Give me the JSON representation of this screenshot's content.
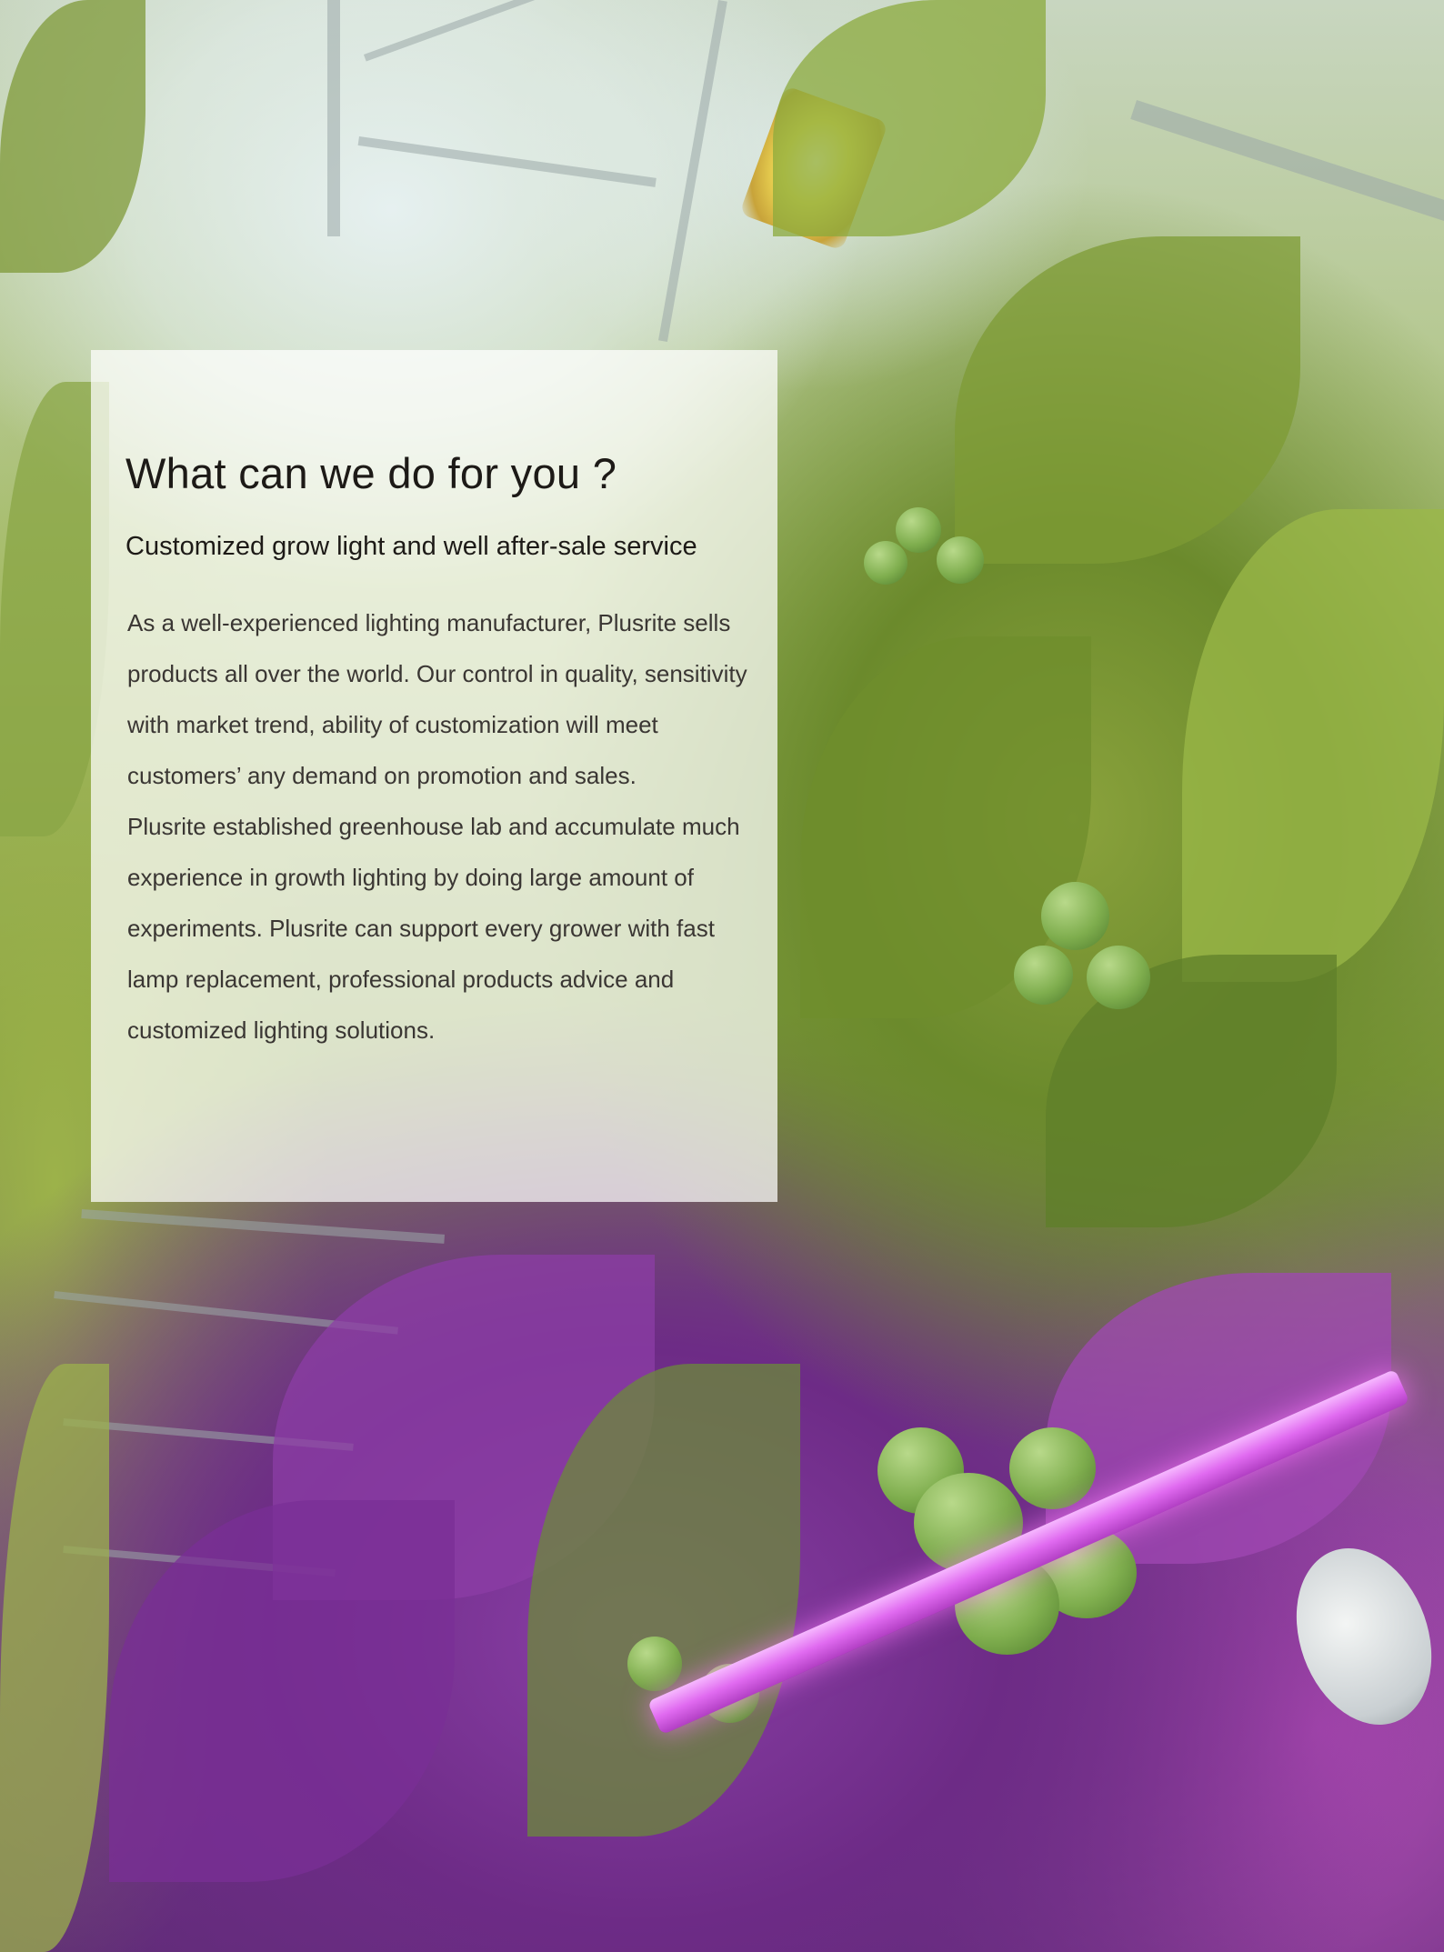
{
  "heading": "What can we do for you ?",
  "subheading": "Customized grow light and well after-sale service",
  "paragraphs": [
    "As a well-experienced lighting manufacturer, Plusrite sells products all over the world. Our control in quality, sensitivity with market trend, ability of customization will meet customers’ any demand on promotion and sales.",
    "Plusrite established greenhouse lab and accumulate much experience in growth lighting by doing large amount of experiments. Plusrite can support every grower with fast lamp replacement, professional products advice and customized lighting solutions."
  ]
}
